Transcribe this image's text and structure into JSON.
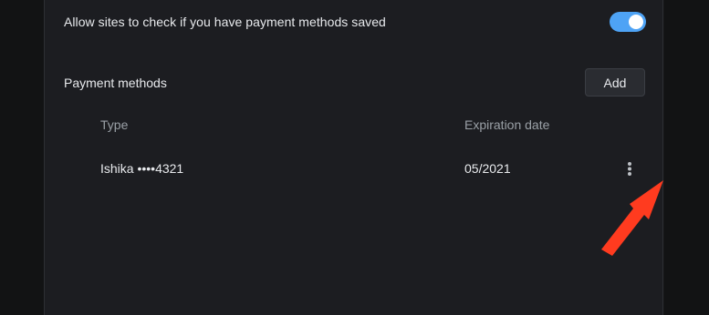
{
  "settings": {
    "toggle_label": "Allow sites to check if you have payment methods saved",
    "toggle_state": "on"
  },
  "payment_methods": {
    "label": "Payment methods",
    "add_label": "Add",
    "columns": {
      "type": "Type",
      "expiration": "Expiration date"
    },
    "rows": [
      {
        "card": "Ishika ••••4321",
        "expiration": "05/2021"
      }
    ]
  },
  "icons": {
    "more": "more-vert-icon",
    "annotation": "red-arrow-annotation"
  },
  "colors": {
    "accent": "#4ea3f5",
    "annotation": "#ff3b1f"
  }
}
